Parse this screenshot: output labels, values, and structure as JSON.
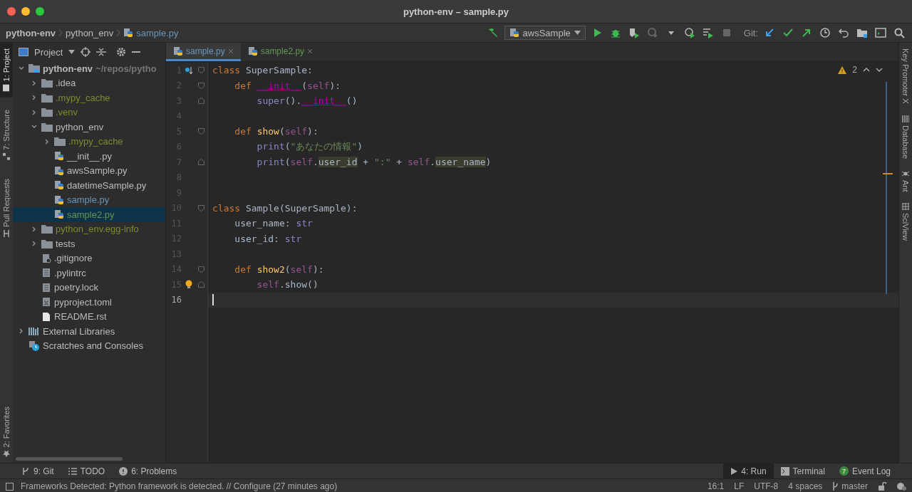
{
  "window": {
    "title": "python-env – sample.py"
  },
  "breadcrumbs": [
    {
      "label": "python-env",
      "kind": "project"
    },
    {
      "label": "python_env",
      "kind": "folder"
    },
    {
      "label": "sample.py",
      "kind": "python"
    }
  ],
  "toolbar": [
    {
      "kind": "build",
      "disabled": false
    },
    {
      "kind": "run_config",
      "label": "awsSample"
    },
    {
      "kind": "run",
      "disabled": false
    },
    {
      "kind": "debug",
      "disabled": false
    },
    {
      "kind": "coverage",
      "disabled": false
    },
    {
      "kind": "profile",
      "disabled": true
    },
    {
      "kind": "dropdown",
      "disabled": false
    },
    {
      "kind": "timer",
      "disabled": false
    },
    {
      "kind": "run_list",
      "disabled": false
    },
    {
      "kind": "stop",
      "disabled": true
    },
    {
      "kind": "label",
      "label": "Git:"
    },
    {
      "kind": "update",
      "disabled": false
    },
    {
      "kind": "commit",
      "disabled": false
    },
    {
      "kind": "push",
      "disabled": false
    },
    {
      "kind": "history",
      "disabled": false
    },
    {
      "kind": "rollback",
      "disabled": false
    },
    {
      "kind": "structure",
      "disabled": false
    },
    {
      "kind": "terminal",
      "disabled": false
    },
    {
      "kind": "search",
      "disabled": false
    }
  ],
  "left_strip": [
    {
      "label": "1: Project",
      "kind": "project",
      "selected": true
    },
    {
      "label": "7: Structure",
      "kind": "structure",
      "selected": false
    },
    {
      "label": "Pull Requests",
      "kind": "pull",
      "selected": false
    }
  ],
  "left_strip_bottom": [
    {
      "label": "2: Favorites",
      "kind": "star",
      "selected": false
    }
  ],
  "project_panel": {
    "title": "Project",
    "tree": [
      {
        "label": "python-env",
        "hint": "~/repos/pytho",
        "kind": "module",
        "color": "#bbbbbb",
        "bold": true,
        "selected": false,
        "expanded": true,
        "children": [
          {
            "label": ".idea",
            "kind": "folder",
            "color": "#bbbbbb",
            "selected": false,
            "expanded": false
          },
          {
            "label": ".mypy_cache",
            "kind": "folder",
            "color": "#7f8b2e",
            "selected": false,
            "expanded": false
          },
          {
            "label": ".venv",
            "kind": "folder",
            "color": "#7f8b2e",
            "selected": false,
            "expanded": false
          },
          {
            "label": "python_env",
            "kind": "folder",
            "color": "#bbbbbb",
            "selected": false,
            "expanded": true,
            "children": [
              {
                "label": ".mypy_cache",
                "kind": "folder",
                "color": "#7f8b2e",
                "selected": false,
                "expanded": false
              },
              {
                "label": "__init__.py",
                "kind": "python",
                "color": "#bbbbbb",
                "selected": false
              },
              {
                "label": "awsSample.py",
                "kind": "python",
                "color": "#bbbbbb",
                "selected": false
              },
              {
                "label": "datetimeSample.py",
                "kind": "python",
                "color": "#bbbbbb",
                "selected": false
              },
              {
                "label": "sample.py",
                "kind": "python",
                "color": "#6897bb",
                "selected": false
              },
              {
                "label": "sample2.py",
                "kind": "python",
                "color": "#629755",
                "selected": true
              }
            ]
          },
          {
            "label": "python_env.egg-info",
            "kind": "folder",
            "color": "#7f8b2e",
            "selected": false,
            "expanded": false
          },
          {
            "label": "tests",
            "kind": "folder",
            "color": "#bbbbbb",
            "selected": false,
            "expanded": false
          },
          {
            "label": ".gitignore",
            "kind": "ignore",
            "color": "#bbbbbb",
            "selected": false
          },
          {
            "label": ".pylintrc",
            "kind": "text",
            "color": "#bbbbbb",
            "selected": false
          },
          {
            "label": "poetry.lock",
            "kind": "text",
            "color": "#bbbbbb",
            "selected": false
          },
          {
            "label": "pyproject.toml",
            "kind": "toml",
            "color": "#bbbbbb",
            "selected": false
          },
          {
            "label": "README.rst",
            "kind": "doc",
            "color": "#bbbbbb",
            "selected": false
          }
        ]
      },
      {
        "label": "External Libraries",
        "kind": "libraries",
        "color": "#bbbbbb",
        "selected": false,
        "expanded": false
      },
      {
        "label": "Scratches and Consoles",
        "kind": "scratches",
        "color": "#bbbbbb",
        "selected": false
      }
    ]
  },
  "tabs": [
    {
      "label": "sample.py",
      "color": "#6897bb",
      "selected": true
    },
    {
      "label": "sample2.py",
      "color": "#629755",
      "selected": false
    }
  ],
  "editor": {
    "warnings": "2",
    "lines": [
      {
        "number": "1",
        "marker": {
          "kind": "override"
        },
        "fold": {
          "kind": "start"
        },
        "current": false,
        "tokens": [
          {
            "text": "class ",
            "kind": "keyword"
          },
          {
            "text": "SuperSample:",
            "kind": "plain"
          }
        ]
      },
      {
        "number": "2",
        "fold": {
          "kind": "start"
        },
        "current": false,
        "tokens": [
          {
            "text": "    def ",
            "kind": "keyword"
          },
          {
            "text": "__init__",
            "kind": "magic"
          },
          {
            "text": "(",
            "kind": "plain"
          },
          {
            "text": "self",
            "kind": "self"
          },
          {
            "text": "):",
            "kind": "plain"
          }
        ]
      },
      {
        "number": "3",
        "fold": {
          "kind": "end"
        },
        "current": false,
        "tokens": [
          {
            "text": "        super",
            "kind": "builtin"
          },
          {
            "text": "().",
            "kind": "plain"
          },
          {
            "text": "__init__",
            "kind": "magic"
          },
          {
            "text": "()",
            "kind": "plain"
          }
        ]
      },
      {
        "number": "4",
        "current": false
      },
      {
        "number": "5",
        "fold": {
          "kind": "start"
        },
        "current": false,
        "tokens": [
          {
            "text": "    def ",
            "kind": "keyword"
          },
          {
            "text": "show",
            "kind": "function"
          },
          {
            "text": "(",
            "kind": "plain"
          },
          {
            "text": "self",
            "kind": "self"
          },
          {
            "text": "):",
            "kind": "plain"
          }
        ]
      },
      {
        "number": "6",
        "current": false,
        "tokens": [
          {
            "text": "        print",
            "kind": "builtin"
          },
          {
            "text": "(",
            "kind": "plain"
          },
          {
            "text": "\"あなたの情報\"",
            "kind": "string"
          },
          {
            "text": ")",
            "kind": "plain"
          }
        ]
      },
      {
        "number": "7",
        "fold": {
          "kind": "end"
        },
        "current": false,
        "tokens": [
          {
            "text": "        print",
            "kind": "builtin"
          },
          {
            "text": "(",
            "kind": "plain"
          },
          {
            "text": "self",
            "kind": "self"
          },
          {
            "text": ".",
            "kind": "plain"
          },
          {
            "text": "user_id",
            "kind": "field"
          },
          {
            "text": " + ",
            "kind": "plain"
          },
          {
            "text": "\":\"",
            "kind": "string"
          },
          {
            "text": " + ",
            "kind": "plain"
          },
          {
            "text": "self",
            "kind": "self"
          },
          {
            "text": ".",
            "kind": "plain"
          },
          {
            "text": "user_name",
            "kind": "field"
          },
          {
            "text": ")",
            "kind": "plain"
          }
        ]
      },
      {
        "number": "8",
        "current": false
      },
      {
        "number": "9",
        "current": false
      },
      {
        "number": "10",
        "fold": {
          "kind": "start"
        },
        "current": false,
        "tokens": [
          {
            "text": "class ",
            "kind": "keyword"
          },
          {
            "text": "Sample(SuperSample):",
            "kind": "plain"
          }
        ]
      },
      {
        "number": "11",
        "current": false,
        "tokens": [
          {
            "text": "    user_name: ",
            "kind": "plain"
          },
          {
            "text": "str",
            "kind": "builtin"
          }
        ]
      },
      {
        "number": "12",
        "current": false,
        "tokens": [
          {
            "text": "    user_id: ",
            "kind": "plain"
          },
          {
            "text": "str",
            "kind": "builtin"
          }
        ]
      },
      {
        "number": "13",
        "current": false
      },
      {
        "number": "14",
        "fold": {
          "kind": "start"
        },
        "current": false,
        "tokens": [
          {
            "text": "    def ",
            "kind": "keyword"
          },
          {
            "text": "show2",
            "kind": "function"
          },
          {
            "text": "(",
            "kind": "plain"
          },
          {
            "text": "self",
            "kind": "self"
          },
          {
            "text": "):",
            "kind": "plain"
          }
        ]
      },
      {
        "number": "15",
        "marker": {
          "kind": "bulb"
        },
        "fold": {
          "kind": "end"
        },
        "current": false,
        "tokens": [
          {
            "text": "        self",
            "kind": "self"
          },
          {
            "text": ".show()",
            "kind": "plain"
          }
        ]
      },
      {
        "number": "16",
        "current": true
      }
    ]
  },
  "right_strip": [
    {
      "label": "Key Promoter X",
      "kind": "none"
    },
    {
      "label": "Database",
      "kind": "database"
    },
    {
      "label": "Ant",
      "kind": "ant"
    },
    {
      "label": "SciView",
      "kind": "grid"
    }
  ],
  "bottom_tools_left": [
    {
      "label": "9: Git",
      "kind": "git",
      "selected": false
    },
    {
      "label": "TODO",
      "kind": "list",
      "selected": false
    },
    {
      "label": "6: Problems",
      "kind": "problems",
      "selected": false
    }
  ],
  "bottom_tools_right": [
    {
      "label": "4: Run",
      "kind": "run",
      "selected": true
    },
    {
      "label": "Terminal",
      "kind": "terminal",
      "selected": false
    },
    {
      "label": "Event Log",
      "kind": "log",
      "badge": "7",
      "selected": false
    }
  ],
  "status_bar": {
    "message": "Frameworks Detected: Python framework is detected. // Configure (27 minutes ago)",
    "items": [
      {
        "label": "16:1",
        "kind": "text"
      },
      {
        "label": "LF",
        "kind": "text"
      },
      {
        "label": "UTF-8",
        "kind": "text"
      },
      {
        "label": "4 spaces",
        "kind": "text"
      },
      {
        "label": "master",
        "kind": "branch"
      }
    ]
  }
}
